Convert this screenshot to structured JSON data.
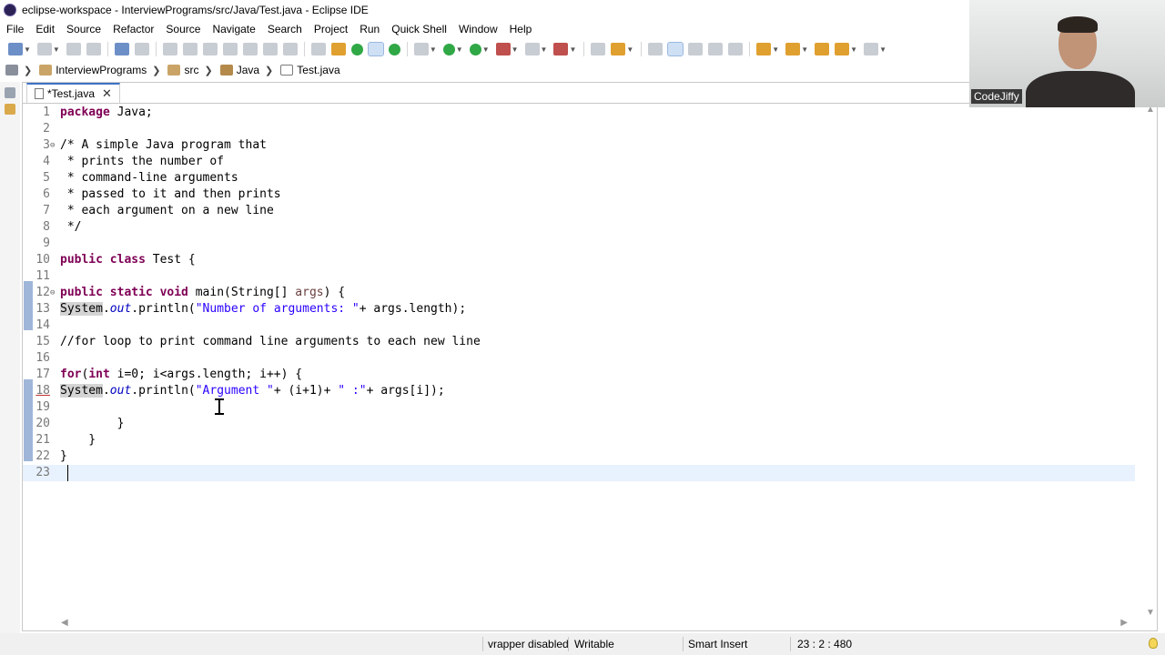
{
  "window": {
    "title": "eclipse-workspace - InterviewPrograms/src/Java/Test.java - Eclipse IDE"
  },
  "menu": [
    "File",
    "Edit",
    "Source",
    "Refactor",
    "Source",
    "Navigate",
    "Search",
    "Project",
    "Run",
    "Quick Shell",
    "Window",
    "Help"
  ],
  "breadcrumb": {
    "project": "InterviewPrograms",
    "src": "src",
    "package": "Java",
    "file": "Test.java"
  },
  "tab": {
    "label": "*Test.java"
  },
  "editor": {
    "current_line": 23,
    "lines": [
      {
        "n": "1"
      },
      {
        "n": "2"
      },
      {
        "n": "3"
      },
      {
        "n": "4"
      },
      {
        "n": "5"
      },
      {
        "n": "6"
      },
      {
        "n": "7"
      },
      {
        "n": "8"
      },
      {
        "n": "9"
      },
      {
        "n": "10"
      },
      {
        "n": "11"
      },
      {
        "n": "12"
      },
      {
        "n": "13"
      },
      {
        "n": "14"
      },
      {
        "n": "15"
      },
      {
        "n": "16"
      },
      {
        "n": "17"
      },
      {
        "n": "18"
      },
      {
        "n": "19"
      },
      {
        "n": "20"
      },
      {
        "n": "21"
      },
      {
        "n": "22"
      },
      {
        "n": "23"
      }
    ]
  },
  "code": {
    "l1_kw": "package",
    "l1_rest": " Java;",
    "l3": "/* A simple Java program that",
    "l4": " * prints the number of",
    "l5": " * command-line arguments",
    "l6": " * passed to it and then prints",
    "l7": " * each argument on a new line",
    "l8": " */",
    "l10_kw": "public class",
    "l10_rest": " Test {",
    "l12_kw": "public static void",
    "l12_a": " main(String[] ",
    "l12_var": "args",
    "l12_b": ") {",
    "l13_sys": "System",
    "l13_dot": ".",
    "l13_out": "out",
    "l13_a": ".println(",
    "l13_str": "\"Number of arguments: \"",
    "l13_b": "+ args.length);",
    "l15": "//for loop to print command line arguments to each new line",
    "l17_kw": "for",
    "l17_a": "(",
    "l17_kw2": "int",
    "l17_b": " i=0; i<args.length; i++) {",
    "l18_sys": "System",
    "l18_dot": ".",
    "l18_out": "out",
    "l18_a": ".println(",
    "l18_str1": "\"Argument \"",
    "l18_b": "+ (i+1)+ ",
    "l18_str2": "\" :\"",
    "l18_c": "+ args[i]);",
    "l20": "        }",
    "l21": "    }",
    "l22": "}"
  },
  "status": {
    "wrapper": "vrapper disabled",
    "writable": "Writable",
    "insert_mode": "Smart Insert",
    "position": "23 : 2 : 480"
  },
  "webcam": {
    "label": "CodeJiffy"
  },
  "icons": [
    "eclipse-icon",
    "new-icon",
    "save-icon",
    "save-all-icon",
    "print-icon",
    "debug-icon",
    "run-icon",
    "search-icon",
    "lightbulb-icon"
  ]
}
